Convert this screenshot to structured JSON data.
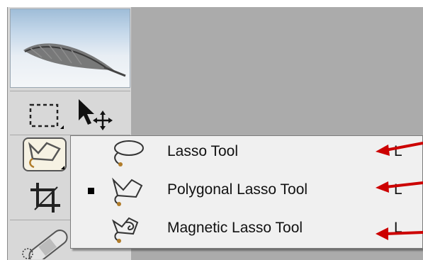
{
  "toolbox": {
    "header_icon": "feather-icon",
    "tools": [
      {
        "name": "rectangular-marquee-icon"
      },
      {
        "name": "move-icon"
      },
      {
        "name": "lasso-icon"
      },
      {
        "name": "crop-icon"
      },
      {
        "name": "healing-brush-icon"
      }
    ]
  },
  "lasso_menu": {
    "items": [
      {
        "label": "Lasso Tool",
        "shortcut": "L",
        "icon": "lasso-icon",
        "checked": false
      },
      {
        "label": "Polygonal Lasso Tool",
        "shortcut": "L",
        "icon": "polygonal-lasso-icon",
        "checked": true
      },
      {
        "label": "Magnetic Lasso Tool",
        "shortcut": "L",
        "icon": "magnetic-lasso-icon",
        "checked": false
      }
    ]
  },
  "colors": {
    "workspace": "#ababab",
    "toolbox": "#d8d8d8",
    "menu": "#f0f0f0",
    "annotation_arrow": "#cc0000"
  }
}
